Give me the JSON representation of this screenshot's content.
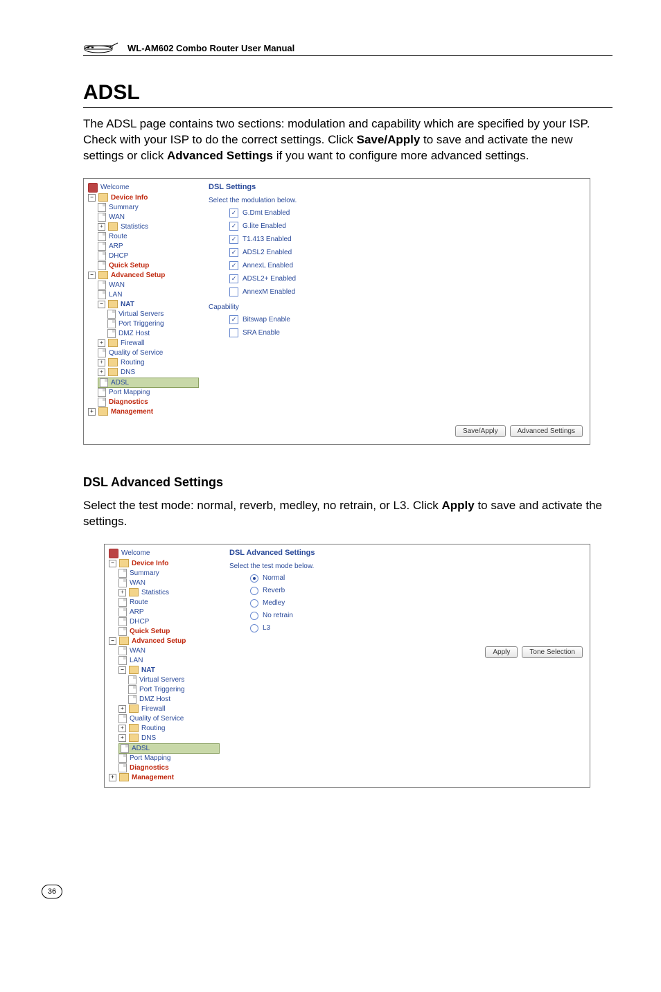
{
  "header": {
    "title": "WL-AM602 Combo Router User Manual"
  },
  "h1": "ADSL",
  "intro": {
    "p1a": "The ADSL page contains two sections: modulation and capability which are specified by your ISP. Check with your ISP to do the correct settings. Click ",
    "bold1": "Save/Apply",
    "p1b": " to save and activate the new settings or click ",
    "bold2": "Advanced Settings",
    "p1c": " if you want to configure more advanced settings."
  },
  "shot1": {
    "nav": {
      "welcome": "Welcome",
      "device_info": "Device Info",
      "summary": "Summary",
      "wan": "WAN",
      "statistics": "Statistics",
      "route": "Route",
      "arp": "ARP",
      "dhcp": "DHCP",
      "quick_setup": "Quick Setup",
      "advanced_setup": "Advanced Setup",
      "wan2": "WAN",
      "lan": "LAN",
      "nat": "NAT",
      "virtual_servers": "Virtual Servers",
      "port_triggering": "Port Triggering",
      "dmz_host": "DMZ Host",
      "firewall": "Firewall",
      "qos": "Quality of Service",
      "routing": "Routing",
      "dns": "DNS",
      "adsl": "ADSL",
      "port_mapping": "Port Mapping",
      "diagnostics": "Diagnostics",
      "management": "Management"
    },
    "panel": {
      "title": "DSL Settings",
      "subtitle": "Select the modulation below.",
      "opts": {
        "gdmt": "G.Dmt Enabled",
        "glite": "G.lite Enabled",
        "t1413": "T1.413 Enabled",
        "adsl2": "ADSL2 Enabled",
        "annexl": "AnnexL Enabled",
        "adsl2p": "ADSL2+ Enabled",
        "annexm": "AnnexM Enabled"
      },
      "cap_label": "Capability",
      "cap_opts": {
        "bitswap": "Bitswap Enable",
        "sra": "SRA Enable"
      },
      "btn_save": "Save/Apply",
      "btn_adv": "Advanced Settings"
    }
  },
  "sub_h2": "DSL Advanced Settings",
  "sub_para": {
    "a": "Select the test mode: normal, reverb, medley, no retrain, or L3. Click ",
    "bold": "Apply",
    "b": " to save and activate the settings."
  },
  "shot2": {
    "nav": {
      "welcome": "Welcome",
      "device_info": "Device Info",
      "summary": "Summary",
      "wan": "WAN",
      "statistics": "Statistics",
      "route": "Route",
      "arp": "ARP",
      "dhcp": "DHCP",
      "quick_setup": "Quick Setup",
      "advanced_setup": "Advanced Setup",
      "wan2": "WAN",
      "lan": "LAN",
      "nat": "NAT",
      "virtual_servers": "Virtual Servers",
      "port_triggering": "Port Triggering",
      "dmz_host": "DMZ Host",
      "firewall": "Firewall",
      "qos": "Quality of Service",
      "routing": "Routing",
      "dns": "DNS",
      "adsl": "ADSL",
      "port_mapping": "Port Mapping",
      "diagnostics": "Diagnostics",
      "management": "Management"
    },
    "panel": {
      "title": "DSL Advanced Settings",
      "subtitle": "Select the test mode below.",
      "opts": {
        "normal": "Normal",
        "reverb": "Reverb",
        "medley": "Medley",
        "noretrain": "No retrain",
        "l3": "L3"
      },
      "btn_apply": "Apply",
      "btn_tone": "Tone Selection"
    }
  },
  "page_number": "36"
}
